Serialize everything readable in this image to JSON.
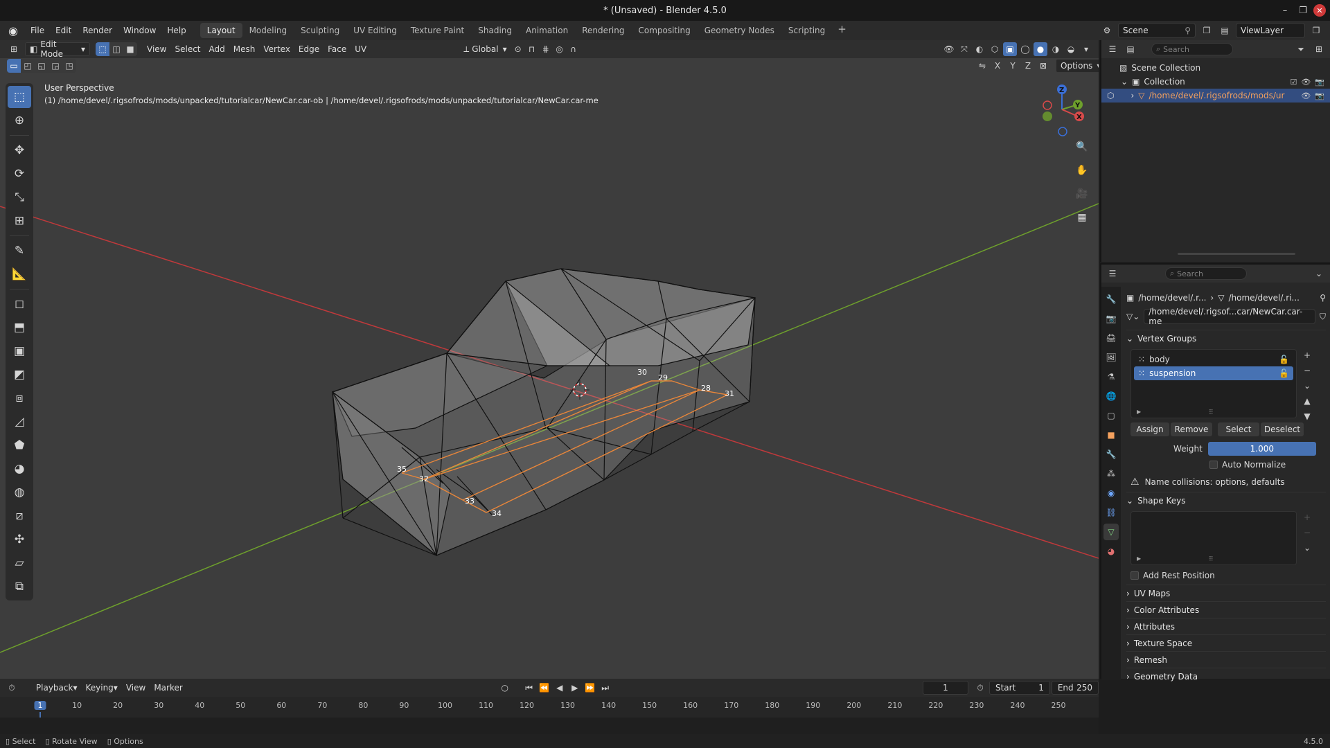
{
  "window": {
    "title": "* (Unsaved) - Blender 4.5.0"
  },
  "menu": [
    "File",
    "Edit",
    "Render",
    "Window",
    "Help"
  ],
  "workspaces": [
    "Layout",
    "Modeling",
    "Sculpting",
    "UV Editing",
    "Texture Paint",
    "Shading",
    "Animation",
    "Rendering",
    "Compositing",
    "Geometry Nodes",
    "Scripting"
  ],
  "active_workspace": "Layout",
  "scene": {
    "name": "Scene",
    "view_layer": "ViewLayer"
  },
  "viewport": {
    "mode": "Edit Mode",
    "menus": [
      "View",
      "Select",
      "Add",
      "Mesh",
      "Vertex",
      "Edge",
      "Face",
      "UV"
    ],
    "orientation": "Global",
    "options_label": "Options",
    "axes": [
      "X",
      "Y",
      "Z"
    ],
    "perspective": "User Perspective",
    "object_info": "(1) /home/devel/.rigsofrods/mods/unpacked/tutorialcar/NewCar.car-ob | /home/devel/.rigsofrods/mods/unpacked/tutorialcar/NewCar.car-me",
    "vertex_labels": [
      "30",
      "29",
      "28",
      "31",
      "35",
      "32",
      "33",
      "34"
    ],
    "gizmo_axes": [
      "Z",
      "Y",
      "X"
    ]
  },
  "outliner": {
    "search_placeholder": "Search",
    "scene_collection": "Scene Collection",
    "collection": "Collection",
    "object": "/home/devel/.rigsofrods/mods/ur"
  },
  "properties": {
    "search_placeholder": "Search",
    "breadcrumb_a": "/home/devel/.r...",
    "breadcrumb_b": "/home/devel/.ri...",
    "mesh_name": "/home/devel/.rigsof...car/NewCar.car-me",
    "vertex_groups_title": "Vertex Groups",
    "vertex_groups": [
      "body",
      "suspension"
    ],
    "selected_group": "suspension",
    "buttons": {
      "assign": "Assign",
      "remove": "Remove",
      "select": "Select",
      "deselect": "Deselect"
    },
    "weight_label": "Weight",
    "weight_value": "1.000",
    "auto_normalize": "Auto Normalize",
    "warning": "Name collisions: options, defaults",
    "shape_keys_title": "Shape Keys",
    "add_rest_position": "Add Rest Position",
    "collapsed_sections": [
      "UV Maps",
      "Color Attributes",
      "Attributes",
      "Texture Space",
      "Remesh",
      "Geometry Data"
    ]
  },
  "timeline": {
    "menus": [
      "Playback",
      "Keying",
      "View",
      "Marker"
    ],
    "current_frame": "1",
    "start_label": "Start",
    "start": "1",
    "end_label": "End",
    "end": "250",
    "ticks": [
      "1",
      "10",
      "20",
      "30",
      "40",
      "50",
      "60",
      "70",
      "80",
      "90",
      "100",
      "110",
      "120",
      "130",
      "140",
      "150",
      "160",
      "170",
      "180",
      "190",
      "200",
      "210",
      "220",
      "230",
      "240",
      "250"
    ]
  },
  "statusbar": {
    "select": "Select",
    "rotate": "Rotate View",
    "options": "Options",
    "version": "4.5.0"
  },
  "colors": {
    "accent": "#4772b3",
    "selected_edge": "#e8863a",
    "x_axis": "#c0393b",
    "y_axis": "#6ea02c",
    "outliner_object": "#f4a15e"
  }
}
